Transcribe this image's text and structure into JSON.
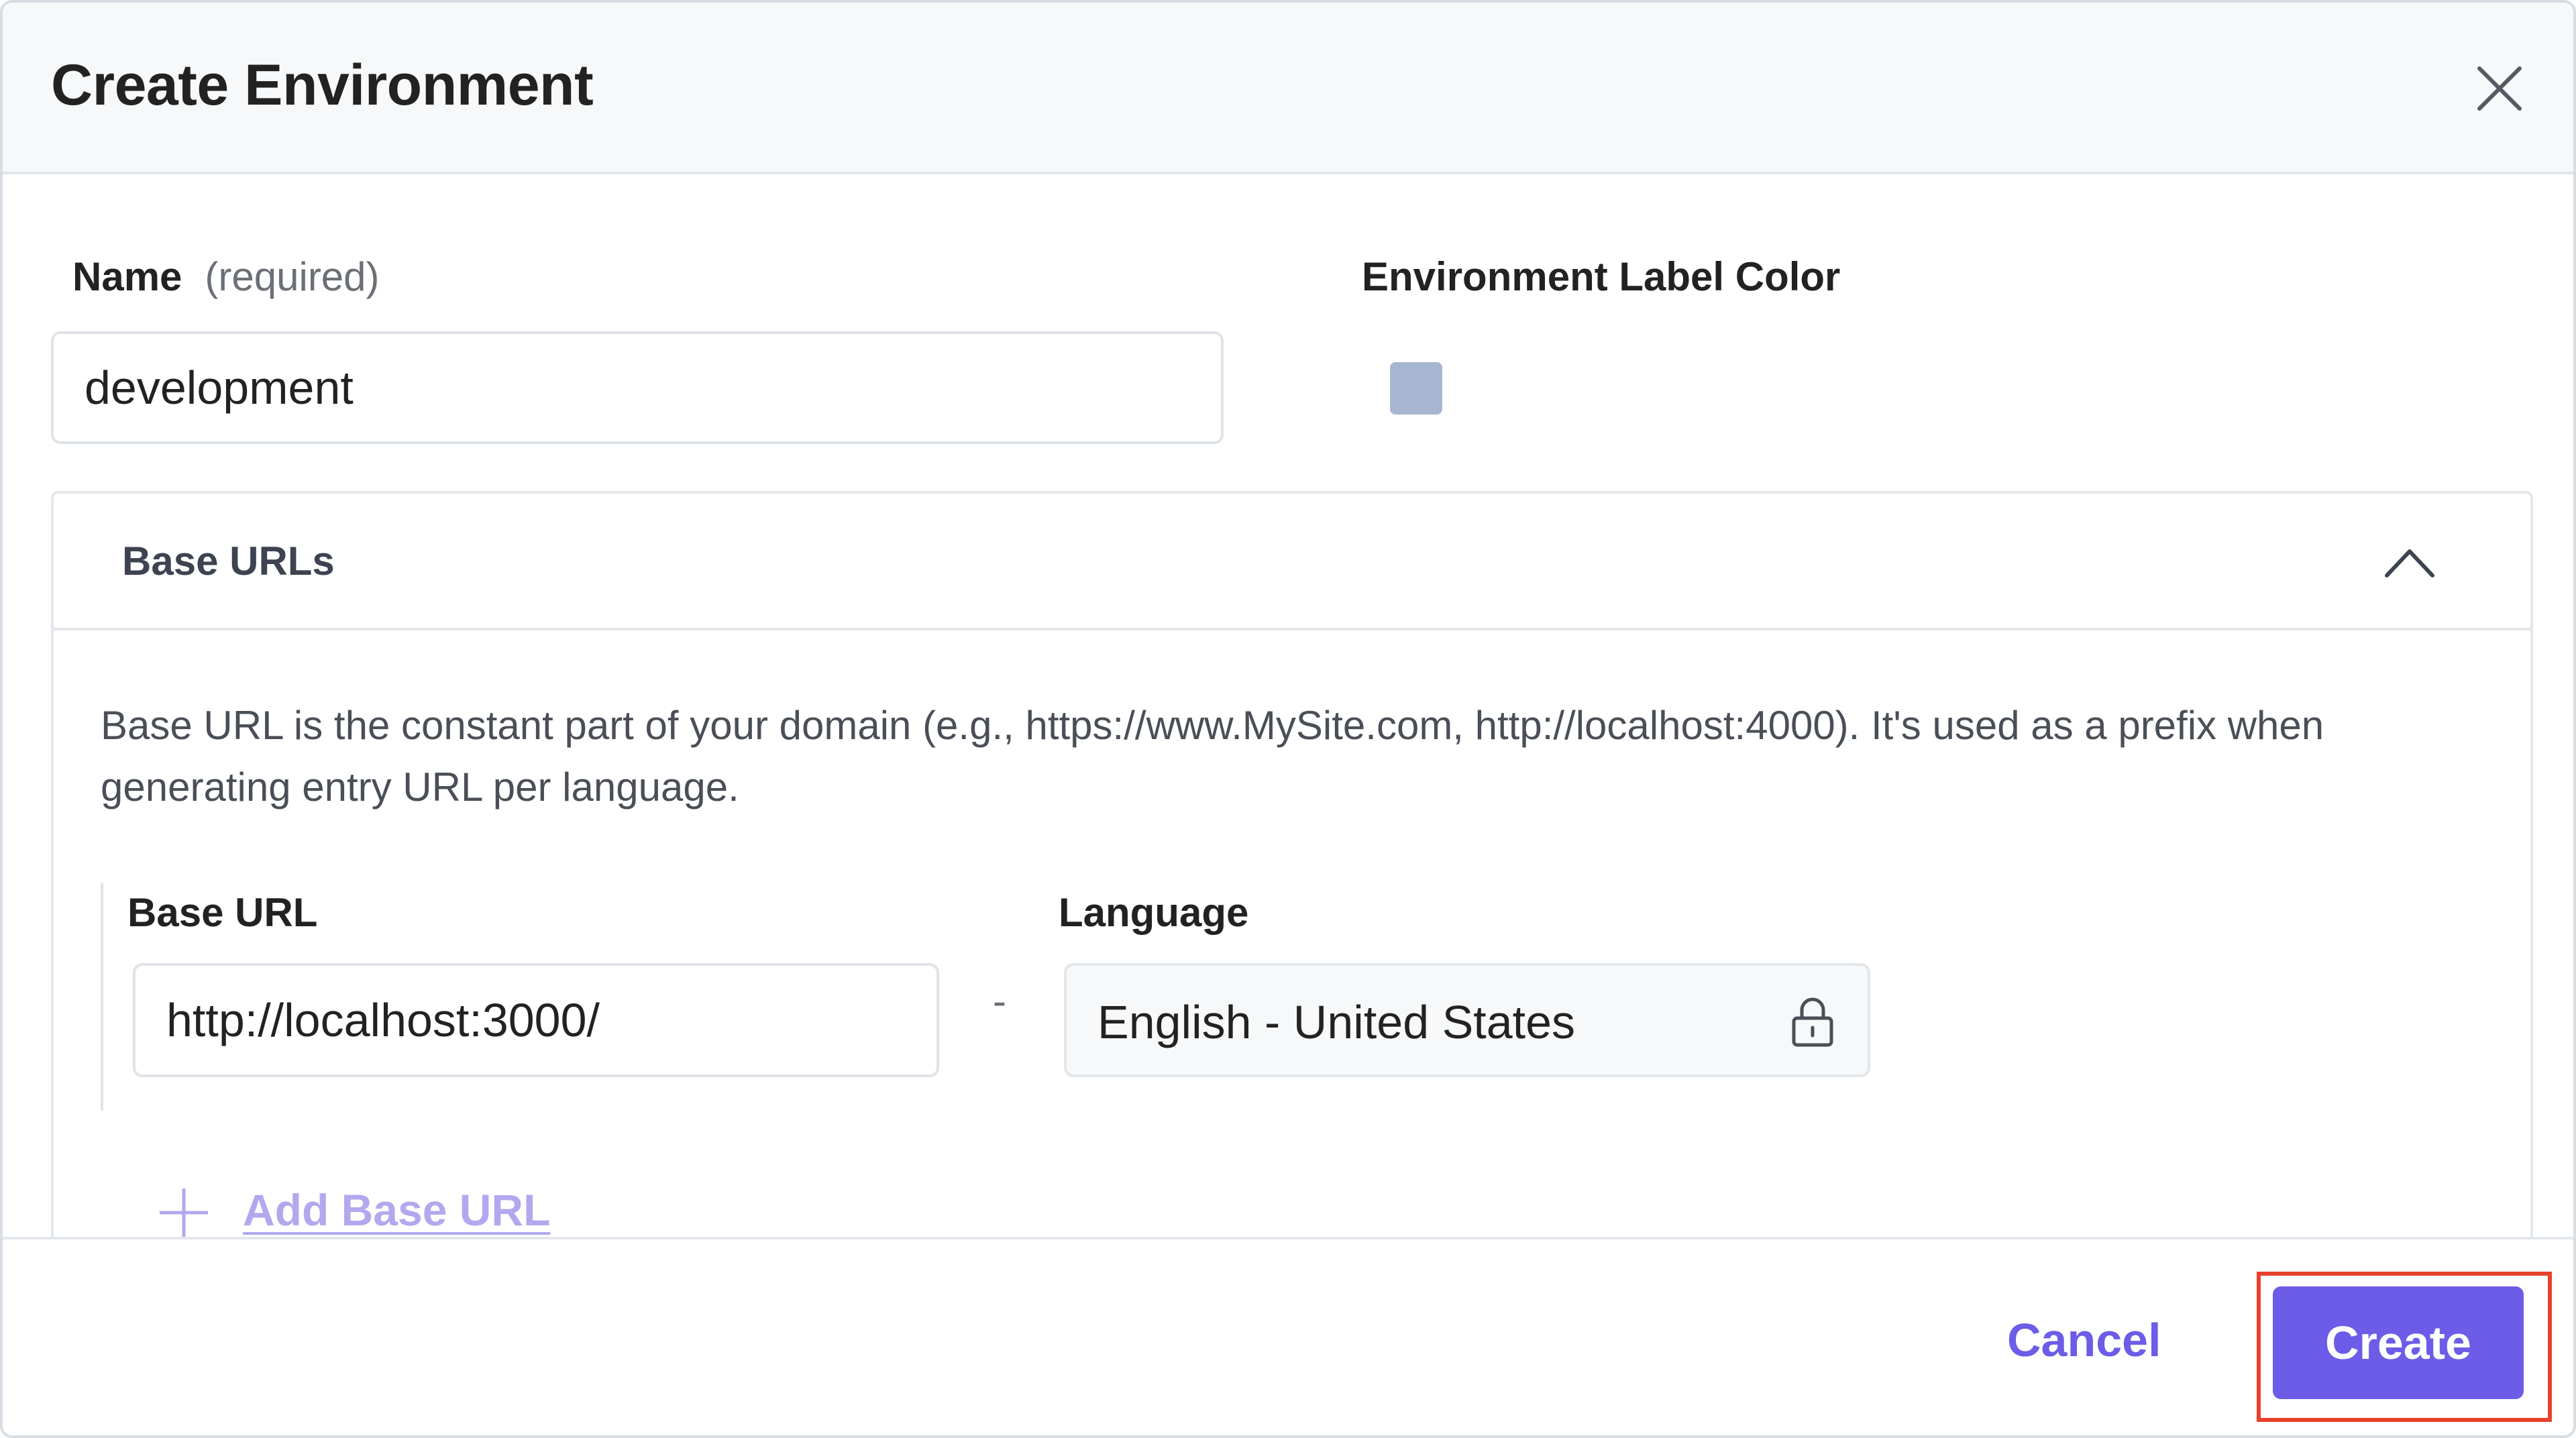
{
  "dialog": {
    "title": "Create Environment"
  },
  "name_field": {
    "label": "Name",
    "hint": "(required)",
    "value": "development"
  },
  "label_color": {
    "label": "Environment Label Color",
    "swatch_color": "#a7b6d0"
  },
  "base_urls": {
    "title": "Base URLs",
    "description": "Base URL is the constant part of your domain (e.g., https://www.MySite.com, http://localhost:4000). It's used as a prefix when generating entry URL per language.",
    "base_url_label": "Base URL",
    "language_label": "Language",
    "separator": "-",
    "rows": [
      {
        "base_url": "http://localhost:3000/",
        "language": "English - United States"
      }
    ],
    "add_label": "Add Base URL"
  },
  "footer": {
    "cancel_label": "Cancel",
    "create_label": "Create"
  },
  "colors": {
    "accent": "#6c5ce7",
    "highlight": "#e8412c",
    "add_link": "#b2a8ee"
  },
  "icons": {
    "close": "close-icon",
    "collapse": "chevron-up-icon",
    "lock": "lock-icon",
    "add": "plus-icon"
  }
}
